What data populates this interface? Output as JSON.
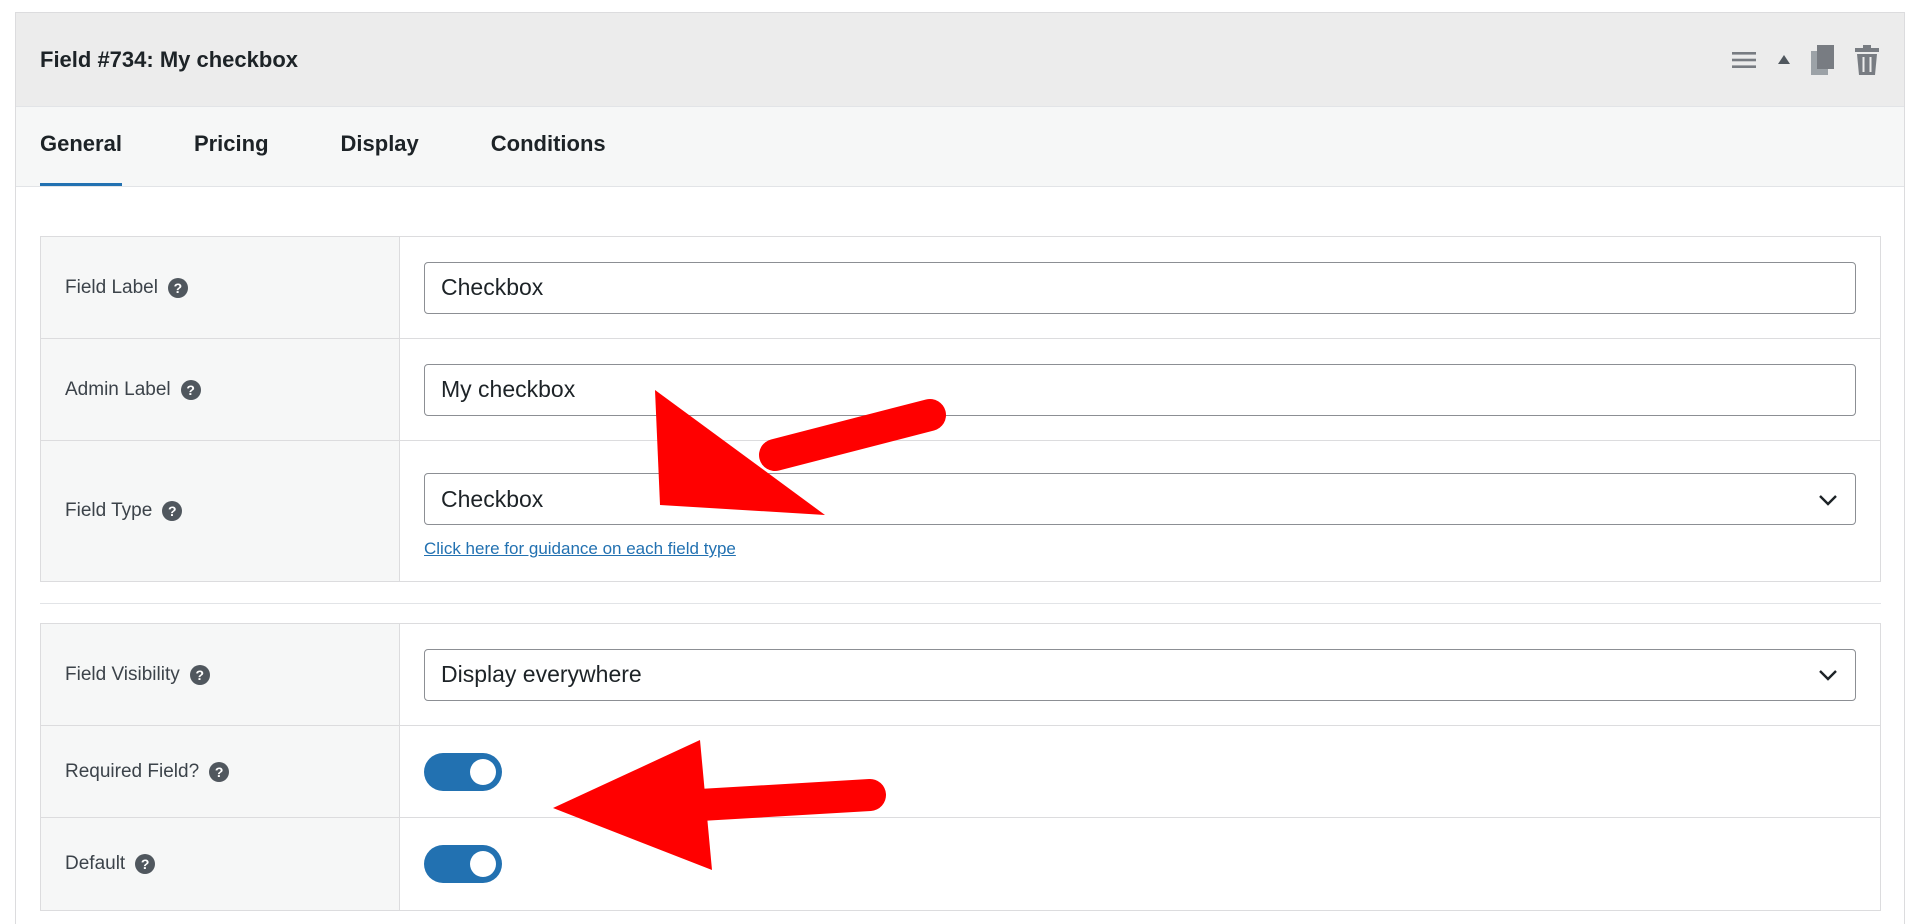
{
  "panel": {
    "title": "Field #734: My checkbox",
    "actions": [
      {
        "name": "menu-icon"
      },
      {
        "name": "collapse-arrow-icon"
      },
      {
        "name": "duplicate-icon"
      },
      {
        "name": "trash-icon"
      }
    ]
  },
  "tabs": [
    {
      "label": "General",
      "active": true
    },
    {
      "label": "Pricing",
      "active": false
    },
    {
      "label": "Display",
      "active": false
    },
    {
      "label": "Conditions",
      "active": false
    }
  ],
  "general": {
    "field_label": {
      "label": "Field Label",
      "value": "Checkbox"
    },
    "admin_label": {
      "label": "Admin Label",
      "value": "My checkbox"
    },
    "field_type": {
      "label": "Field Type",
      "value": "Checkbox",
      "help_link": "Click here for guidance on each field type"
    },
    "field_visibility": {
      "label": "Field Visibility",
      "value": "Display everywhere"
    },
    "required_field": {
      "label": "Required Field?",
      "enabled": true
    },
    "default": {
      "label": "Default",
      "enabled": true
    }
  },
  "help_glyph": "?",
  "colors": {
    "accent": "#2271b1",
    "annotation_arrow": "#ff0000"
  }
}
